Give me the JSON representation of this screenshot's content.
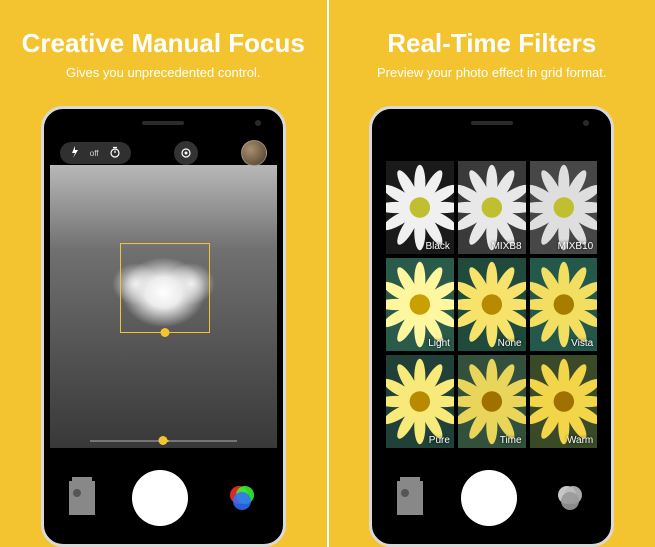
{
  "panels": [
    {
      "title": "Creative Manual Focus",
      "subtitle": "Gives you unprecedented control."
    },
    {
      "title": "Real-Time Filters",
      "subtitle": "Preview your photo effect in grid format."
    }
  ],
  "camera_topbar": {
    "flash_label": "off"
  },
  "filters": [
    {
      "name": "Black",
      "bg": "#1a1a1a",
      "petal": "#f0f0f0",
      "center": "#bfbf30"
    },
    {
      "name": "MIXB8",
      "bg": "#3a3a3a",
      "petal": "#e8e8e8",
      "center": "#bfbf30"
    },
    {
      "name": "MIXB10",
      "bg": "#474747",
      "petal": "#dedede",
      "center": "#bfbf30"
    },
    {
      "name": "Light",
      "bg": "#2a5a4a",
      "petal": "#fff6a0",
      "center": "#caa000"
    },
    {
      "name": "None",
      "bg": "#1f4a3c",
      "petal": "#f7e36b",
      "center": "#b88a00"
    },
    {
      "name": "Vista",
      "bg": "#23584a",
      "petal": "#f2de60",
      "center": "#a77d00"
    },
    {
      "name": "Pure",
      "bg": "#204038",
      "petal": "#f7e97a",
      "center": "#b88a00"
    },
    {
      "name": "Time",
      "bg": "#32503c",
      "petal": "#e8d55a",
      "center": "#a07000"
    },
    {
      "name": "Warm",
      "bg": "#3a4a28",
      "petal": "#f2d548",
      "center": "#a07000"
    }
  ]
}
